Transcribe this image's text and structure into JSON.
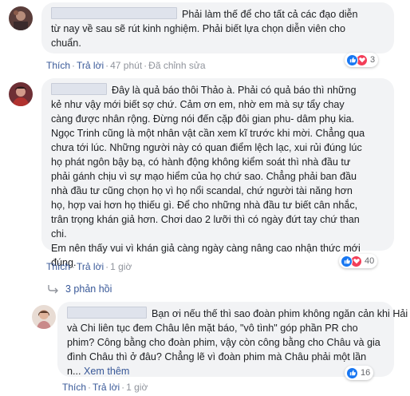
{
  "comments": [
    {
      "avatar": "user-avatar-1",
      "lines": [
        "Phải làm thế để cho tất cả các đạo diễn",
        "từ nay về sau sẽ rút kinh nghiệm. Phải biết lựa chọn diễn viên cho",
        "chuẩn."
      ],
      "actions": {
        "like": "Thích",
        "reply": "Trả lời",
        "time": "47 phút",
        "edited": "Đã chỉnh sửa"
      },
      "reactions": {
        "count": "3"
      }
    },
    {
      "avatar": "user-avatar-2",
      "lines": [
        "Đây là quả báo thôi Thảo à. Phải có quả báo thì những",
        "kẻ như vậy mới biết sợ chứ. Cảm ơn em, nhờ em mà sự tẩy chay",
        "càng được nhân rộng. Đừng nói đến cặp đôi gian phu- dâm phụ kia.",
        "Ngọc Trinh cũng là một nhân vật cần xem kĩ trước khi mời. Chẳng qua",
        "chưa tới lúc. Những người này có quan điểm lệch lạc, xui rủi đúng lúc",
        "họ phát ngôn bậy bạ, có hành động không kiểm soát thì nhà đầu tư",
        "phải gánh chịu vì sự mạo hiểm của họ chứ sao. Chẳng phải ban đầu",
        "nhà đầu tư cũng chọn họ vì họ nổi scandal, chứ người tài năng hơn",
        "họ, hợp vai hơn họ thiếu gì. Để cho những nhà đầu tư biết cân nhắc,",
        "trân trọng khán giả hơn. Chơi dao 2 lưỡi thì có ngày đứt tay chứ than",
        "chi.",
        "Em nên thấy vui vì khán giả càng ngày càng nâng cao nhận thức mới",
        "đúng."
      ],
      "actions": {
        "like": "Thích",
        "reply": "Trả lời",
        "time": "1 giờ"
      },
      "reactions": {
        "count": "40"
      },
      "replies_label": "3 phản hồi"
    },
    {
      "avatar": "user-avatar-3",
      "lines": [
        "Bạn ơi nếu thế thì sao đoàn phim không ngăn cản khi Hải",
        "và Chi liên tục đem Châu lên mặt báo, \"vô tình\" góp phần PR cho",
        "phim? Công bằng cho đoàn phim, vậy còn công bằng cho Châu và gia",
        "đình Châu thì ở đâu? Chẳng lẽ vì đoàn phim mà Châu phải một lần",
        "n..."
      ],
      "see_more": "Xem thêm",
      "actions": {
        "like": "Thích",
        "reply": "Trả lời",
        "time": "1 giờ"
      },
      "reactions": {
        "count": "16"
      }
    }
  ]
}
